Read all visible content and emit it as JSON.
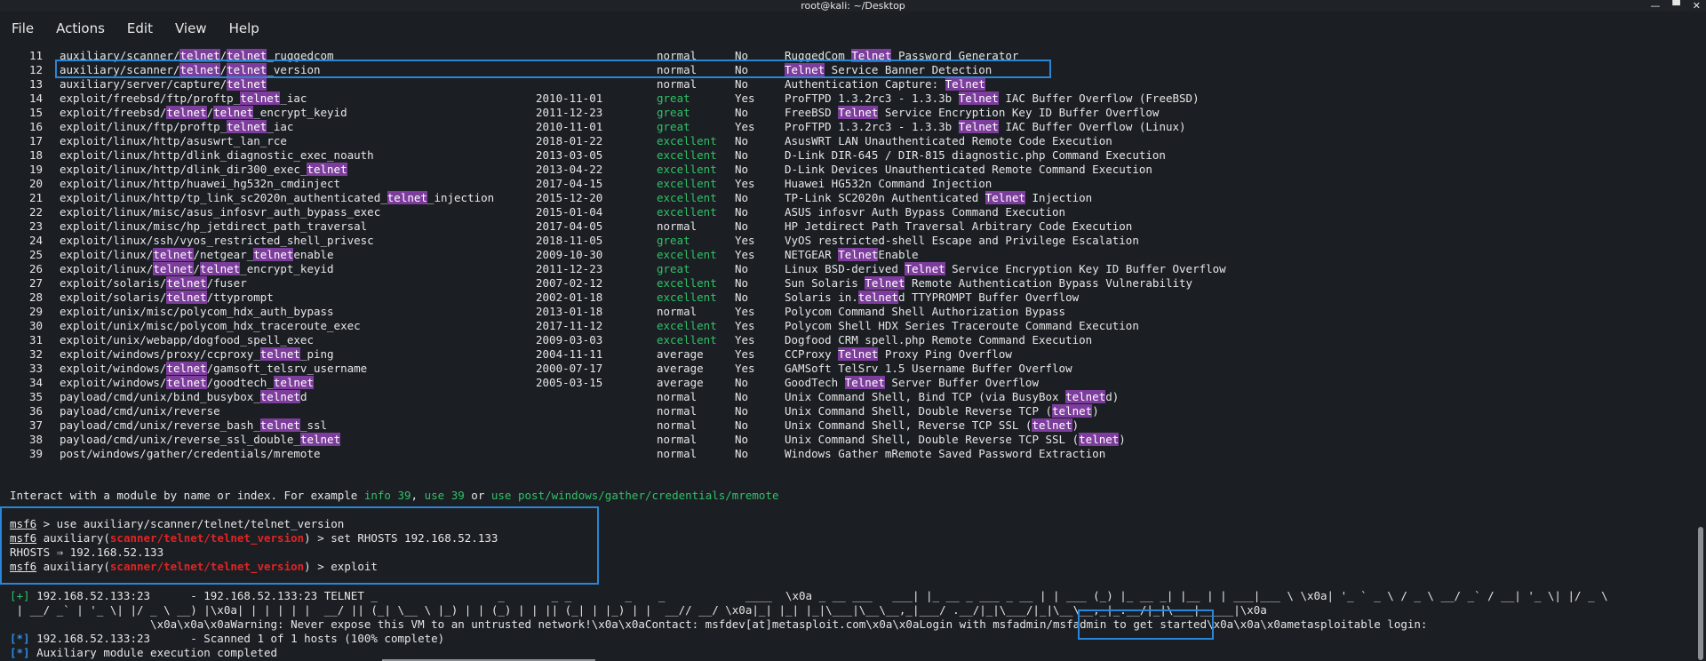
{
  "window": {
    "title": "root@kali: ~/Desktop",
    "controls": [
      "—",
      "▀",
      "✕"
    ]
  },
  "menubar": [
    "File",
    "Actions",
    "Edit",
    "View",
    "Help"
  ],
  "modules": [
    {
      "num": "11",
      "name": [
        [
          "auxiliary/scanner/",
          false
        ],
        [
          "telnet",
          true
        ],
        [
          "/",
          false
        ],
        [
          "telnet",
          true
        ],
        [
          "_ruggedcom",
          false
        ]
      ],
      "date": "",
      "rank": "normal",
      "check": "No",
      "desc": [
        [
          "RuggedCom ",
          false
        ],
        [
          "Telnet",
          true
        ],
        [
          " Password Generator",
          false
        ]
      ]
    },
    {
      "num": "12",
      "name": [
        [
          "auxiliary/scanner/",
          false
        ],
        [
          "telnet",
          true
        ],
        [
          "/",
          false
        ],
        [
          "telnet",
          true
        ],
        [
          "_version",
          false
        ]
      ],
      "date": "",
      "rank": "normal",
      "check": "No",
      "desc": [
        [
          "Telnet",
          true
        ],
        [
          " Service Banner Detection",
          false
        ]
      ]
    },
    {
      "num": "13",
      "name": [
        [
          "auxiliary/server/capture/",
          false
        ],
        [
          "telnet",
          true
        ]
      ],
      "date": "",
      "rank": "normal",
      "check": "No",
      "desc": [
        [
          "Authentication Capture: ",
          false
        ],
        [
          "Telnet",
          true
        ]
      ]
    },
    {
      "num": "14",
      "name": [
        [
          "exploit/freebsd/ftp/proftp_",
          false
        ],
        [
          "telnet",
          true
        ],
        [
          "_iac",
          false
        ]
      ],
      "date": "2010-11-01",
      "rank": "great",
      "check": "Yes",
      "desc": [
        [
          "ProFTPD 1.3.2rc3 - 1.3.3b ",
          false
        ],
        [
          "Telnet",
          true
        ],
        [
          " IAC Buffer Overflow (FreeBSD)",
          false
        ]
      ]
    },
    {
      "num": "15",
      "name": [
        [
          "exploit/freebsd/",
          false
        ],
        [
          "telnet",
          true
        ],
        [
          "/",
          false
        ],
        [
          "telnet",
          true
        ],
        [
          "_encrypt_keyid",
          false
        ]
      ],
      "date": "2011-12-23",
      "rank": "great",
      "check": "No",
      "desc": [
        [
          "FreeBSD ",
          false
        ],
        [
          "Telnet",
          true
        ],
        [
          " Service Encryption Key ID Buffer Overflow",
          false
        ]
      ]
    },
    {
      "num": "16",
      "name": [
        [
          "exploit/linux/ftp/proftp_",
          false
        ],
        [
          "telnet",
          true
        ],
        [
          "_iac",
          false
        ]
      ],
      "date": "2010-11-01",
      "rank": "great",
      "check": "Yes",
      "desc": [
        [
          "ProFTPD 1.3.2rc3 - 1.3.3b ",
          false
        ],
        [
          "Telnet",
          true
        ],
        [
          " IAC Buffer Overflow (Linux)",
          false
        ]
      ]
    },
    {
      "num": "17",
      "name": [
        [
          "exploit/linux/http/asuswrt_lan_rce",
          false
        ]
      ],
      "date": "2018-01-22",
      "rank": "excellent",
      "check": "No",
      "desc": [
        [
          "AsusWRT LAN Unauthenticated Remote Code Execution",
          false
        ]
      ]
    },
    {
      "num": "18",
      "name": [
        [
          "exploit/linux/http/dlink_diagnostic_exec_noauth",
          false
        ]
      ],
      "date": "2013-03-05",
      "rank": "excellent",
      "check": "No",
      "desc": [
        [
          "D-Link DIR-645 / DIR-815 diagnostic.php Command Execution",
          false
        ]
      ]
    },
    {
      "num": "19",
      "name": [
        [
          "exploit/linux/http/dlink_dir300_exec_",
          false
        ],
        [
          "telnet",
          true
        ]
      ],
      "date": "2013-04-22",
      "rank": "excellent",
      "check": "No",
      "desc": [
        [
          "D-Link Devices Unauthenticated Remote Command Execution",
          false
        ]
      ]
    },
    {
      "num": "20",
      "name": [
        [
          "exploit/linux/http/huawei_hg532n_cmdinject",
          false
        ]
      ],
      "date": "2017-04-15",
      "rank": "excellent",
      "check": "Yes",
      "desc": [
        [
          "Huawei HG532n Command Injection",
          false
        ]
      ]
    },
    {
      "num": "21",
      "name": [
        [
          "exploit/linux/http/tp_link_sc2020n_authenticated_",
          false
        ],
        [
          "telnet",
          true
        ],
        [
          "_injection",
          false
        ]
      ],
      "date": "2015-12-20",
      "rank": "excellent",
      "check": "No",
      "desc": [
        [
          "TP-Link SC2020n Authenticated ",
          false
        ],
        [
          "Telnet",
          true
        ],
        [
          " Injection",
          false
        ]
      ]
    },
    {
      "num": "22",
      "name": [
        [
          "exploit/linux/misc/asus_infosvr_auth_bypass_exec",
          false
        ]
      ],
      "date": "2015-01-04",
      "rank": "excellent",
      "check": "No",
      "desc": [
        [
          "ASUS infosvr Auth Bypass Command Execution",
          false
        ]
      ]
    },
    {
      "num": "23",
      "name": [
        [
          "exploit/linux/misc/hp_jetdirect_path_traversal",
          false
        ]
      ],
      "date": "2017-04-05",
      "rank": "normal",
      "check": "No",
      "desc": [
        [
          "HP Jetdirect Path Traversal Arbitrary Code Execution",
          false
        ]
      ]
    },
    {
      "num": "24",
      "name": [
        [
          "exploit/linux/ssh/vyos_restricted_shell_privesc",
          false
        ]
      ],
      "date": "2018-11-05",
      "rank": "great",
      "check": "Yes",
      "desc": [
        [
          "VyOS restricted-shell Escape and Privilege Escalation",
          false
        ]
      ]
    },
    {
      "num": "25",
      "name": [
        [
          "exploit/linux/",
          false
        ],
        [
          "telnet",
          true
        ],
        [
          "/netgear_",
          false
        ],
        [
          "telnet",
          true
        ],
        [
          "enable",
          false
        ]
      ],
      "date": "2009-10-30",
      "rank": "excellent",
      "check": "Yes",
      "desc": [
        [
          "NETGEAR ",
          false
        ],
        [
          "Telnet",
          true
        ],
        [
          "Enable",
          false
        ]
      ]
    },
    {
      "num": "26",
      "name": [
        [
          "exploit/linux/",
          false
        ],
        [
          "telnet",
          true
        ],
        [
          "/",
          false
        ],
        [
          "telnet",
          true
        ],
        [
          "_encrypt_keyid",
          false
        ]
      ],
      "date": "2011-12-23",
      "rank": "great",
      "check": "No",
      "desc": [
        [
          "Linux BSD-derived ",
          false
        ],
        [
          "Telnet",
          true
        ],
        [
          " Service Encryption Key ID Buffer Overflow",
          false
        ]
      ]
    },
    {
      "num": "27",
      "name": [
        [
          "exploit/solaris/",
          false
        ],
        [
          "telnet",
          true
        ],
        [
          "/fuser",
          false
        ]
      ],
      "date": "2007-02-12",
      "rank": "excellent",
      "check": "No",
      "desc": [
        [
          "Sun Solaris ",
          false
        ],
        [
          "Telnet",
          true
        ],
        [
          " Remote Authentication Bypass Vulnerability",
          false
        ]
      ]
    },
    {
      "num": "28",
      "name": [
        [
          "exploit/solaris/",
          false
        ],
        [
          "telnet",
          true
        ],
        [
          "/ttyprompt",
          false
        ]
      ],
      "date": "2002-01-18",
      "rank": "excellent",
      "check": "No",
      "desc": [
        [
          "Solaris in.",
          false
        ],
        [
          "telnet",
          true
        ],
        [
          "d TTYPROMPT Buffer Overflow",
          false
        ]
      ]
    },
    {
      "num": "29",
      "name": [
        [
          "exploit/unix/misc/polycom_hdx_auth_bypass",
          false
        ]
      ],
      "date": "2013-01-18",
      "rank": "normal",
      "check": "Yes",
      "desc": [
        [
          "Polycom Command Shell Authorization Bypass",
          false
        ]
      ]
    },
    {
      "num": "30",
      "name": [
        [
          "exploit/unix/misc/polycom_hdx_traceroute_exec",
          false
        ]
      ],
      "date": "2017-11-12",
      "rank": "excellent",
      "check": "Yes",
      "desc": [
        [
          "Polycom Shell HDX Series Traceroute Command Execution",
          false
        ]
      ]
    },
    {
      "num": "31",
      "name": [
        [
          "exploit/unix/webapp/dogfood_spell_exec",
          false
        ]
      ],
      "date": "2009-03-03",
      "rank": "excellent",
      "check": "Yes",
      "desc": [
        [
          "Dogfood CRM spell.php Remote Command Execution",
          false
        ]
      ]
    },
    {
      "num": "32",
      "name": [
        [
          "exploit/windows/proxy/ccproxy_",
          false
        ],
        [
          "telnet",
          true
        ],
        [
          "_ping",
          false
        ]
      ],
      "date": "2004-11-11",
      "rank": "average",
      "check": "Yes",
      "desc": [
        [
          "CCProxy ",
          false
        ],
        [
          "Telnet",
          true
        ],
        [
          " Proxy Ping Overflow",
          false
        ]
      ]
    },
    {
      "num": "33",
      "name": [
        [
          "exploit/windows/",
          false
        ],
        [
          "telnet",
          true
        ],
        [
          "/gamsoft_telsrv_username",
          false
        ]
      ],
      "date": "2000-07-17",
      "rank": "average",
      "check": "Yes",
      "desc": [
        [
          "GAMSoft TelSrv 1.5 Username Buffer Overflow",
          false
        ]
      ]
    },
    {
      "num": "34",
      "name": [
        [
          "exploit/windows/",
          false
        ],
        [
          "telnet",
          true
        ],
        [
          "/goodtech_",
          false
        ],
        [
          "telnet",
          true
        ]
      ],
      "date": "2005-03-15",
      "rank": "average",
      "check": "No",
      "desc": [
        [
          "GoodTech ",
          false
        ],
        [
          "Telnet",
          true
        ],
        [
          " Server Buffer Overflow",
          false
        ]
      ]
    },
    {
      "num": "35",
      "name": [
        [
          "payload/cmd/unix/bind_busybox_",
          false
        ],
        [
          "telnet",
          true
        ],
        [
          "d",
          false
        ]
      ],
      "date": "",
      "rank": "normal",
      "check": "No",
      "desc": [
        [
          "Unix Command Shell, Bind TCP (via BusyBox ",
          false
        ],
        [
          "telnet",
          true
        ],
        [
          "d)",
          false
        ]
      ]
    },
    {
      "num": "36",
      "name": [
        [
          "payload/cmd/unix/reverse",
          false
        ]
      ],
      "date": "",
      "rank": "normal",
      "check": "No",
      "desc": [
        [
          "Unix Command Shell, Double Reverse TCP (",
          false
        ],
        [
          "telnet",
          true
        ],
        [
          ")",
          false
        ]
      ]
    },
    {
      "num": "37",
      "name": [
        [
          "payload/cmd/unix/reverse_bash_",
          false
        ],
        [
          "telnet",
          true
        ],
        [
          "_ssl",
          false
        ]
      ],
      "date": "",
      "rank": "normal",
      "check": "No",
      "desc": [
        [
          "Unix Command Shell, Reverse TCP SSL (",
          false
        ],
        [
          "telnet",
          true
        ],
        [
          ")",
          false
        ]
      ]
    },
    {
      "num": "38",
      "name": [
        [
          "payload/cmd/unix/reverse_ssl_double_",
          false
        ],
        [
          "telnet",
          true
        ]
      ],
      "date": "",
      "rank": "normal",
      "check": "No",
      "desc": [
        [
          "Unix Command Shell, Double Reverse TCP SSL (",
          false
        ],
        [
          "telnet",
          true
        ],
        [
          ")",
          false
        ]
      ]
    },
    {
      "num": "39",
      "name": [
        [
          "post/windows/gather/credentials/mremote",
          false
        ]
      ],
      "date": "",
      "rank": "normal",
      "check": "No",
      "desc": [
        [
          "Windows Gather mRemote Saved Password Extraction",
          false
        ]
      ]
    }
  ],
  "interact_hint": {
    "prefix": "Interact with a module by name or index. For example ",
    "ex1": "info 39",
    "sep1": ", ",
    "ex2": "use 39",
    "sep2": " or ",
    "ex3": "use post/windows/gather/credentials/mremote"
  },
  "commands": [
    {
      "prompt": "msf6",
      "module": "",
      "text": " > use auxiliary/scanner/telnet/telnet_version"
    },
    {
      "prompt": "msf6",
      "module": "scanner/telnet/telnet_version",
      "text": " > set RHOSTS 192.168.52.133"
    },
    {
      "prompt": "",
      "module": "",
      "text": "RHOSTS ⇒ 192.168.52.133"
    },
    {
      "prompt": "msf6",
      "module": "scanner/telnet/telnet_version",
      "text": " > exploit"
    }
  ],
  "prompt_prefix": " auxiliary(",
  "prompt_suffix": ")",
  "output": {
    "line1_tag": "[+]",
    "line1": " 192.168.52.133:23      - 192.168.52.133:23 TELNET _                  _       _ _        _    _            ____  \\x0a _ __ ___   ___| |_ __ _ ___ _ __ | | ___ (_) |_ __ _| |__ | | ___|___ \\ \\x0a| '_ ` _ \\ / _ \\ __/ _` / __| '_ \\| |/ _ \\",
    "line2": " | __/ _` | '_ \\| |/ _ \\ __) |\\x0a| | | | | |  __/ || (_| \\__ \\ |_) | | (_) | | || (_| | |_) | |  __// __/ \\x0a|_| |_| |_|\\___|\\__\\__,_|___/ .__/|_|\\___/|_|\\__\\__,_|_.__/|_|\\___|_____|\\x0a",
    "line3_pre": "                     \\x0a\\x0a\\x0aWarning: Never expose this VM to an untrusted network!\\x0a\\x0aContact: msfdev[at]metasploit.com\\x0a\\x0aLogin with ",
    "line3_cred": "msfadmin/msfadmin",
    "line3_post": " to get started\\x0a\\x0a\\x0ametasploitable login:",
    "line4_tag": "[*]",
    "line4": " 192.168.52.133:23      - Scanned 1 of 1 hosts (100% complete)",
    "line5_tag": "[*]",
    "line5": " Auxiliary module execution completed"
  },
  "colors": {
    "background": "#1b1e23",
    "highlight": "#7d3d9c",
    "success_green": "#2fc267",
    "module_red": "#e02424",
    "status_blue": "#2f8be6",
    "annotation_box": "#2a86d6"
  }
}
